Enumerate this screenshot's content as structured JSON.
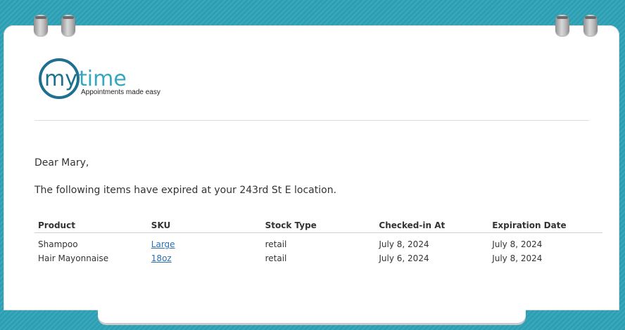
{
  "brand": {
    "name_part1": "my",
    "name_part2": "time",
    "tagline": "Appointments made easy",
    "color_primary": "#1f6f8f",
    "color_accent": "#35a7be"
  },
  "email": {
    "greeting": "Dear Mary,",
    "message": "The following items have expired at your 243rd St E location."
  },
  "table": {
    "headers": [
      "Product",
      "SKU",
      "Stock Type",
      "Checked-in At",
      "Expiration Date"
    ],
    "rows": [
      {
        "product": "Shampoo",
        "sku": "Large",
        "stock_type": "retail",
        "checked_in": "July 8, 2024",
        "expiration": "July 8, 2024"
      },
      {
        "product": "Hair Mayonnaise",
        "sku": "18oz",
        "stock_type": "retail",
        "checked_in": "July 6, 2024",
        "expiration": "July 8, 2024"
      }
    ]
  },
  "colors": {
    "background": "#2b9fb3",
    "link": "#2a6fb4"
  }
}
